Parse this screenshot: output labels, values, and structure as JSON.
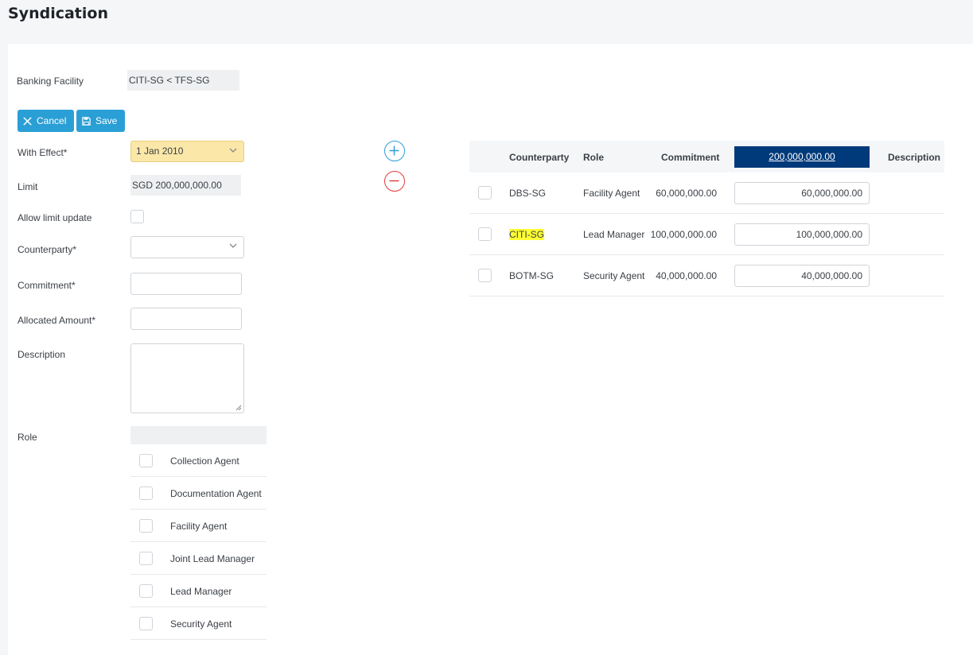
{
  "page": {
    "title": "Syndication"
  },
  "form": {
    "banking_facility": {
      "label": "Banking Facility",
      "value": "CITI-SG < TFS-SG"
    },
    "buttons": {
      "cancel": "Cancel",
      "save": "Save"
    },
    "with_effect": {
      "label": "With Effect*",
      "value": "1 Jan 2010"
    },
    "limit": {
      "label": "Limit",
      "value": "SGD 200,000,000.00"
    },
    "allow_limit_update": {
      "label": "Allow limit update"
    },
    "counterparty": {
      "label": "Counterparty*",
      "value": ""
    },
    "commitment": {
      "label": "Commitment*",
      "value": ""
    },
    "allocated_amount": {
      "label": "Allocated Amount*",
      "value": ""
    },
    "description": {
      "label": "Description",
      "value": ""
    },
    "role": {
      "label": "Role",
      "options": [
        "Collection Agent",
        "Documentation Agent",
        "Facility Agent",
        "Joint Lead Manager",
        "Lead Manager",
        "Security Agent"
      ]
    }
  },
  "table": {
    "headers": {
      "counterparty": "Counterparty",
      "role": "Role",
      "commitment": "Commitment",
      "total": "200,000,000.00",
      "description": "Description"
    },
    "rows": [
      {
        "counterparty": "DBS-SG",
        "role": "Facility Agent",
        "commitment": "60,000,000.00",
        "allocated": "60,000,000.00",
        "description": ""
      },
      {
        "counterparty": "CITI-SG",
        "role": "Lead Manager",
        "commitment": "100,000,000.00",
        "allocated": "100,000,000.00",
        "description": ""
      },
      {
        "counterparty": "BOTM-SG",
        "role": "Security Agent",
        "commitment": "40,000,000.00",
        "allocated": "40,000,000.00",
        "description": ""
      }
    ]
  },
  "colors": {
    "primary_button": "#2a9fd6",
    "header_total": "#003a7a",
    "add": "#2a9fd6",
    "remove": "#e03b3b",
    "highlight": "#ffff33",
    "with_effect_bg": "#fbe7a8"
  },
  "icons": {
    "cancel": "close-icon",
    "save": "save-icon",
    "add": "plus-circle-icon",
    "remove": "minus-circle-icon",
    "dropdown": "chevron-down-icon"
  }
}
